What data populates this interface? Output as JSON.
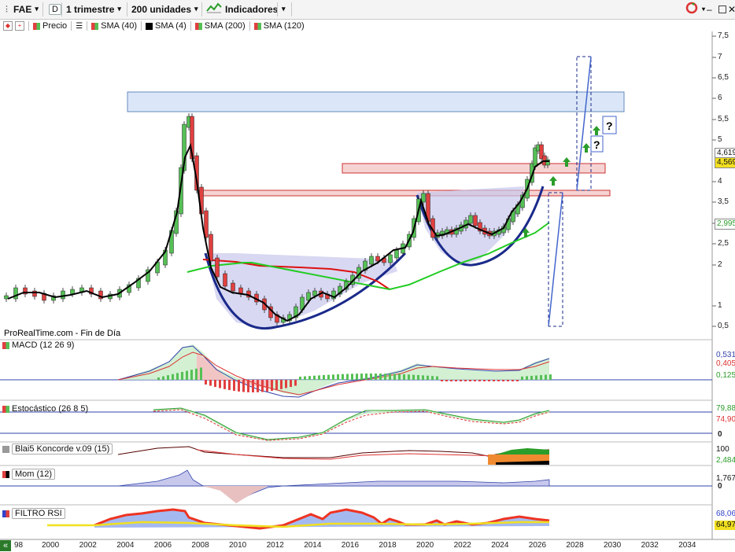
{
  "toolbar": {
    "instrument": "FAE",
    "d_label": "D",
    "period": "1 trimestre",
    "units": "200 unidades",
    "indicators": "Indicadores"
  },
  "legend": {
    "price": "Precio",
    "sma40": "SMA (40)",
    "sma4": "SMA (4)",
    "sma200": "SMA (200)",
    "sma120": "SMA (120)"
  },
  "source_text": "ProRealTime.com - Fin de Día",
  "panels": {
    "macd": "MACD (12 26 9)",
    "stoch": "Estocástico (26 8 5)",
    "koncorde": "Blai5 Koncorde v.09 (15)",
    "mom": "Mom (12)",
    "rsi": "FILTRO RSI"
  },
  "price_axis": [
    "7,5",
    "7",
    "6,5",
    "6",
    "5,5",
    "5",
    "4",
    "3,5",
    "3",
    "2,5",
    "2",
    "1",
    "0,5"
  ],
  "price_tags": {
    "last": "4,619",
    "close": "4,569",
    "sma": "2,995"
  },
  "macd_tags": [
    "0,531",
    "0,405",
    "0,125"
  ],
  "stoch_tags": [
    "79,88",
    "74,90"
  ],
  "stoch_axis": "0",
  "koncorde_tags": [
    "100",
    "2,484"
  ],
  "mom_tags": [
    "1,767",
    "0"
  ],
  "rsi_tags": [
    "68,06",
    "64,97"
  ],
  "question_marks": [
    "?",
    "?"
  ],
  "x_axis": [
    "98",
    "2000",
    "2002",
    "2004",
    "2006",
    "2008",
    "2010",
    "2012",
    "2014",
    "2016",
    "2018",
    "2020",
    "2022",
    "2024",
    "2026",
    "2028",
    "2030",
    "2032",
    "2034"
  ],
  "colors": {
    "sma200": "#22cc22",
    "sma120": "#dd1111",
    "sma4": "#000000",
    "bull": "#55c055",
    "bear": "#e04040"
  },
  "chart_data": {
    "type": "line",
    "title": "FAE",
    "timeframe": "1 trimestre",
    "x": [
      "1998",
      "2000",
      "2002",
      "2004",
      "2006",
      "2007",
      "2008",
      "2010",
      "2012",
      "2014",
      "2016",
      "2018",
      "2020",
      "2021",
      "2022",
      "2024",
      "2025",
      "2026"
    ],
    "series": [
      {
        "name": "Precio",
        "values": [
          1.0,
          1.2,
          1.15,
          1.3,
          2.2,
          5.6,
          3.5,
          1.3,
          0.65,
          1.0,
          2.0,
          2.4,
          3.6,
          2.5,
          2.9,
          3.0,
          4.0,
          4.57
        ]
      },
      {
        "name": "SMA (200)",
        "values": [
          null,
          null,
          null,
          null,
          null,
          null,
          null,
          null,
          null,
          null,
          null,
          1.5,
          1.6,
          1.8,
          1.95,
          2.1,
          2.6,
          3.0
        ]
      },
      {
        "name": "SMA (120)",
        "values": [
          null,
          null,
          null,
          null,
          null,
          null,
          1.9,
          2.05,
          2.0,
          2.0,
          1.9,
          1.6,
          null,
          null,
          null,
          null,
          null,
          null
        ]
      }
    ],
    "ylim": [
      0.5,
      7.5
    ]
  }
}
